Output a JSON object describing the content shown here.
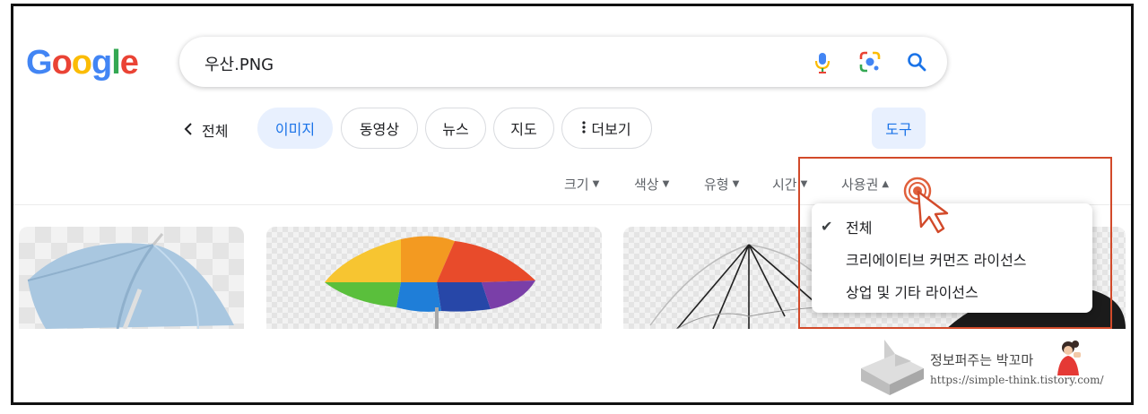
{
  "logo": {
    "letters": [
      "G",
      "o",
      "o",
      "g",
      "l",
      "e"
    ],
    "colors": [
      "#4285F4",
      "#EA4335",
      "#FBBC05",
      "#4285F4",
      "#34A853",
      "#EA4335"
    ]
  },
  "search": {
    "query": "우산.PNG",
    "icons": [
      "microphone-icon",
      "google-lens-icon",
      "search-icon"
    ]
  },
  "nav": {
    "back_label": "전체",
    "chips": [
      {
        "label": "이미지",
        "active": true
      },
      {
        "label": "동영상",
        "active": false
      },
      {
        "label": "뉴스",
        "active": false
      },
      {
        "label": "지도",
        "active": false
      },
      {
        "label": "더보기",
        "active": false
      }
    ],
    "tools_label": "도구"
  },
  "filters": [
    {
      "label": "크기",
      "caret": "▼"
    },
    {
      "label": "색상",
      "caret": "▼"
    },
    {
      "label": "유형",
      "caret": "▼"
    },
    {
      "label": "시간",
      "caret": "▼"
    },
    {
      "label": "사용권",
      "caret": "▲"
    }
  ],
  "dropdown": {
    "check_icon": "✔",
    "items": [
      {
        "label": "전체",
        "selected": true
      },
      {
        "label": "크리에이티브 커먼즈 라이선스",
        "selected": false
      },
      {
        "label": "상업 및 기타 라이선스",
        "selected": false
      }
    ]
  },
  "thumbnails": [
    "light-blue-umbrella",
    "rainbow-umbrella",
    "white-wire-umbrella",
    "black-umbrella"
  ],
  "colors": {
    "accent": "#1a73e8",
    "chip_active_bg": "#e8f0fe",
    "highlight": "#d24a2a"
  },
  "watermark": {
    "title": "정보퍼주는 박꼬마",
    "url": "https://simple-think.tistory.com/"
  }
}
